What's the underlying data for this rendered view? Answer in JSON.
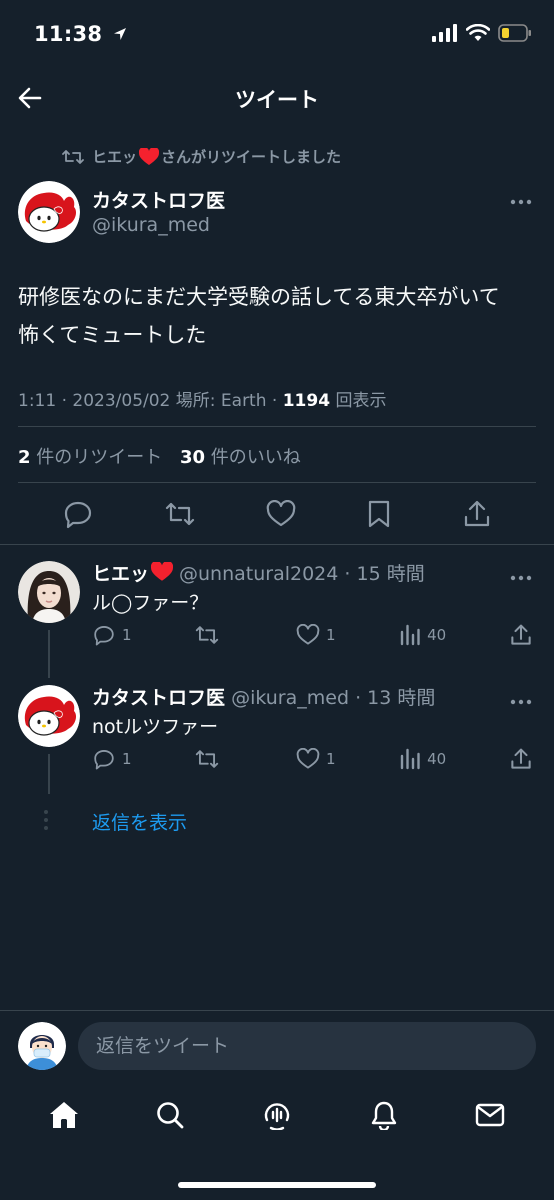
{
  "status_bar": {
    "time": "11:38"
  },
  "header": {
    "title": "ツイート"
  },
  "retweet_banner": {
    "user": "ヒエッ",
    "text": "さんがリツイートしました"
  },
  "tweet": {
    "author_name": "カタストロフ医",
    "author_handle": "@ikura_med",
    "text_line1": "研修医なのにまだ大学受験の話してる東大卒がいて",
    "text_line2": "怖くてミュートした",
    "time": "1:11 · 2023/05/02",
    "location": " 場所: Earth · ",
    "views_count": "1194",
    "views_label": " 回表示",
    "retweets_count": "2",
    "retweets_label": " 件のリツイート",
    "likes_count": "30",
    "likes_label": " 件のいいね"
  },
  "replies": [
    {
      "name": "ヒエッ",
      "handle": "@unnatural2024",
      "time": "· 15 時間",
      "text": "ル◯ファー？",
      "reply_count": "1",
      "like_count": "1",
      "view_count": "40"
    },
    {
      "name": "カタストロフ医",
      "handle": "@ikura_med",
      "time": "· 13 時間",
      "text": "notルツファー",
      "reply_count": "1",
      "like_count": "1",
      "view_count": "40"
    }
  ],
  "show_replies": "返信を表示",
  "composer": {
    "placeholder": "返信をツイート"
  },
  "colors": {
    "background": "#15202b",
    "accent": "#1d9bf0",
    "heart": "#f4212e",
    "muted": "#8b98a5"
  },
  "icons": [
    "back-arrow-icon",
    "retweet-icon",
    "heart-icon",
    "more-icon",
    "reply-icon",
    "like-icon",
    "bookmark-icon",
    "share-icon",
    "views-icon",
    "home-icon",
    "search-icon",
    "spaces-icon",
    "notifications-icon",
    "messages-icon",
    "signal-icon",
    "wifi-icon",
    "battery-icon",
    "location-arrow-icon"
  ]
}
